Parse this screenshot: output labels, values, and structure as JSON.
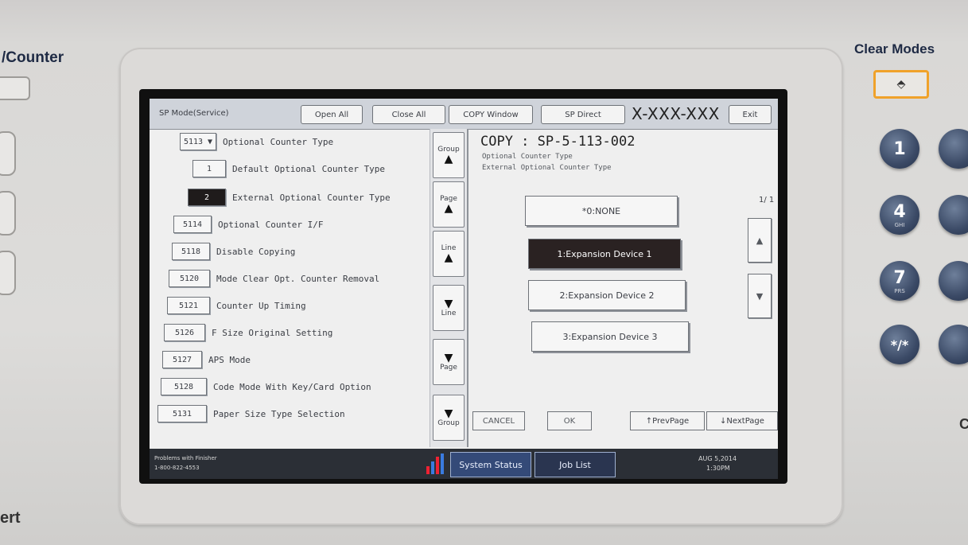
{
  "panel": {
    "counter_label": "/Counter",
    "clear_modes_label": "Clear Modes",
    "bottom_left_label": "ert",
    "right_edge_label": "C",
    "keypad": [
      {
        "digit": "1",
        "sub": ""
      },
      {
        "digit": "4",
        "sub": "GHI"
      },
      {
        "digit": "7",
        "sub": "PRS"
      },
      {
        "digit": "*/*",
        "sub": ""
      }
    ]
  },
  "topbar": {
    "mode": "SP Mode(Service)",
    "open_all": "Open All",
    "close_all": "Close All",
    "copy_window": "COPY Window",
    "sp_direct": "SP Direct",
    "model": "X-XXX-XXX",
    "exit": "Exit"
  },
  "list": [
    {
      "num": "5113 ▼",
      "label": "Optional Counter Type",
      "selected": false
    },
    {
      "num": "1",
      "label": "Default Optional Counter Type",
      "selected": false
    },
    {
      "num": "2",
      "label": "External Optional Counter Type",
      "selected": true
    },
    {
      "num": "5114",
      "label": "Optional Counter I/F",
      "selected": false
    },
    {
      "num": "5118",
      "label": "Disable Copying",
      "selected": false
    },
    {
      "num": "5120",
      "label": "Mode Clear Opt. Counter Removal",
      "selected": false
    },
    {
      "num": "5121",
      "label": "Counter Up Timing",
      "selected": false
    },
    {
      "num": "5126",
      "label": "F Size Original Setting",
      "selected": false
    },
    {
      "num": "5127",
      "label": "APS Mode",
      "selected": false
    },
    {
      "num": "5128",
      "label": "Code Mode With Key/Card Option",
      "selected": false
    },
    {
      "num": "5131",
      "label": "Paper Size Type Selection",
      "selected": false
    }
  ],
  "nav": {
    "group_up": "Group",
    "page_up": "Page",
    "line_up": "Line",
    "line_down": "Line",
    "page_down": "Page",
    "group_down": "Group"
  },
  "detail": {
    "title": "COPY : SP-5-113-002",
    "line1": "Optional Counter Type",
    "line2": "External Optional Counter Type",
    "page": "1/ 1",
    "options": [
      {
        "label": "*0:NONE",
        "selected": false
      },
      {
        "label": "1:Expansion Device 1",
        "selected": true
      },
      {
        "label": "2:Expansion Device 2",
        "selected": false
      },
      {
        "label": "3:Expansion Device 3",
        "selected": false
      }
    ],
    "cancel": "CANCEL",
    "ok": "OK",
    "prev_page": "↑PrevPage",
    "next_page": "↓NextPage"
  },
  "status": {
    "problem": "Problems with Finisher",
    "phone": "1-800-822-4553",
    "system_status": "System Status",
    "job_list": "Job List",
    "date": "AUG  5,2014",
    "time": "1:30PM"
  }
}
